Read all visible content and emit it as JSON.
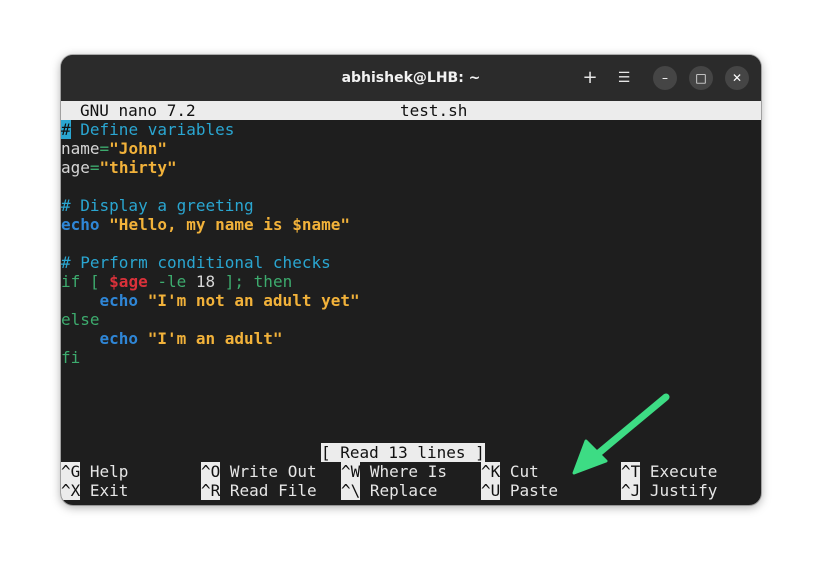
{
  "window": {
    "title": "abhishek@LHB: ~"
  },
  "titlebar_buttons": {
    "new_tab": "+",
    "menu": "☰",
    "minimize": "–",
    "maximize": "□",
    "close": "✕"
  },
  "nano": {
    "version": "GNU nano 7.2",
    "filename": "test.sh",
    "status": "[ Read 13 lines ]"
  },
  "code": {
    "l1_hash": "#",
    "l1_comment": " Define variables",
    "l2_var": "name",
    "l2_eq": "=",
    "l2_val": "\"John\"",
    "l3_var": "age",
    "l3_eq": "=",
    "l3_val": "\"thirty\"",
    "l5_comment": "# Display a greeting",
    "l6_echo": "echo",
    "l6_str": "\"Hello, my name is $name\"",
    "l8_comment": "# Perform conditional checks",
    "l9_if": "if [ ",
    "l9_var": "$age",
    "l9_op": " -le ",
    "l9_num": "18",
    "l9_rest": " ]; then",
    "l10_indent": "    ",
    "l10_echo": "echo",
    "l10_str": " \"I'm not an adult yet\"",
    "l11_else": "else",
    "l12_indent": "    ",
    "l12_echo": "echo",
    "l12_str": " \"I'm an adult\"",
    "l13_fi": "fi"
  },
  "shortcuts": [
    {
      "key": "^G",
      "label": " Help"
    },
    {
      "key": "^O",
      "label": " Write Out"
    },
    {
      "key": "^W",
      "label": " Where Is"
    },
    {
      "key": "^K",
      "label": " Cut"
    },
    {
      "key": "^T",
      "label": " Execute"
    },
    {
      "key": "^X",
      "label": " Exit"
    },
    {
      "key": "^R",
      "label": " Read File"
    },
    {
      "key": "^\\",
      "label": " Replace"
    },
    {
      "key": "^U",
      "label": " Paste"
    },
    {
      "key": "^J",
      "label": " Justify"
    }
  ],
  "colors": {
    "comment": "#2aa6d1",
    "string": "#f2b23a",
    "keyword": "#2f86d6",
    "variable": "#d9313a",
    "builtin": "#3dab6e",
    "annotation_arrow": "#3ddc84"
  },
  "icons": {
    "annotation": "arrow-icon"
  }
}
